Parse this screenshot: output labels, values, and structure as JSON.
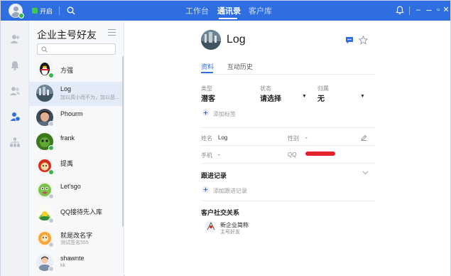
{
  "topbar": {
    "status_label": "开启",
    "tabs": [
      "工作台",
      "通讯录",
      "客户库"
    ],
    "active_tab": 1
  },
  "colors": {
    "brand_blue": "#2f6ee0",
    "online_green": "#3cb34a",
    "redaction_red": "#e8202c"
  },
  "rail": {
    "icons": [
      "add-contact-icon",
      "bell-icon",
      "group-icon",
      "customer-icon",
      "org-chart-icon"
    ],
    "active_index": 3
  },
  "list": {
    "title": "企业主号好友",
    "search_placeholder": "",
    "contacts": [
      {
        "name": "方强",
        "sub": ""
      },
      {
        "name": "Log",
        "sub": "加以真小而不为，加以恶..."
      },
      {
        "name": "Phourm",
        "sub": ""
      },
      {
        "name": "frank",
        "sub": ""
      },
      {
        "name": "提禹",
        "sub": ""
      },
      {
        "name": "Let'sgo",
        "sub": ""
      },
      {
        "name": "QQ接待先入库",
        "sub": ""
      },
      {
        "name": "就是改名字",
        "sub": "测试签名555"
      },
      {
        "name": "shawnte",
        "sub": "kk"
      }
    ],
    "selected_index": 1
  },
  "detail": {
    "name": "Log",
    "tabs": [
      "资料",
      "互动历史"
    ],
    "active_tab": 0,
    "type_label": "类型",
    "type_value": "潜客",
    "status_label": "状态",
    "status_value": "请选择",
    "owner_label": "归属",
    "owner_value": "无",
    "add_tag": "添加标签",
    "name_label": "姓名",
    "name_value": "Log",
    "gender_label": "性别",
    "gender_value": "-",
    "phone_label": "手机",
    "phone_value": "-",
    "qq_label": "QQ",
    "followup_title": "跟进记录",
    "add_followup": "添加跟进记录",
    "social_title": "客户社交关系",
    "social_line1": "新企业简称",
    "social_line2": "主号好友"
  }
}
